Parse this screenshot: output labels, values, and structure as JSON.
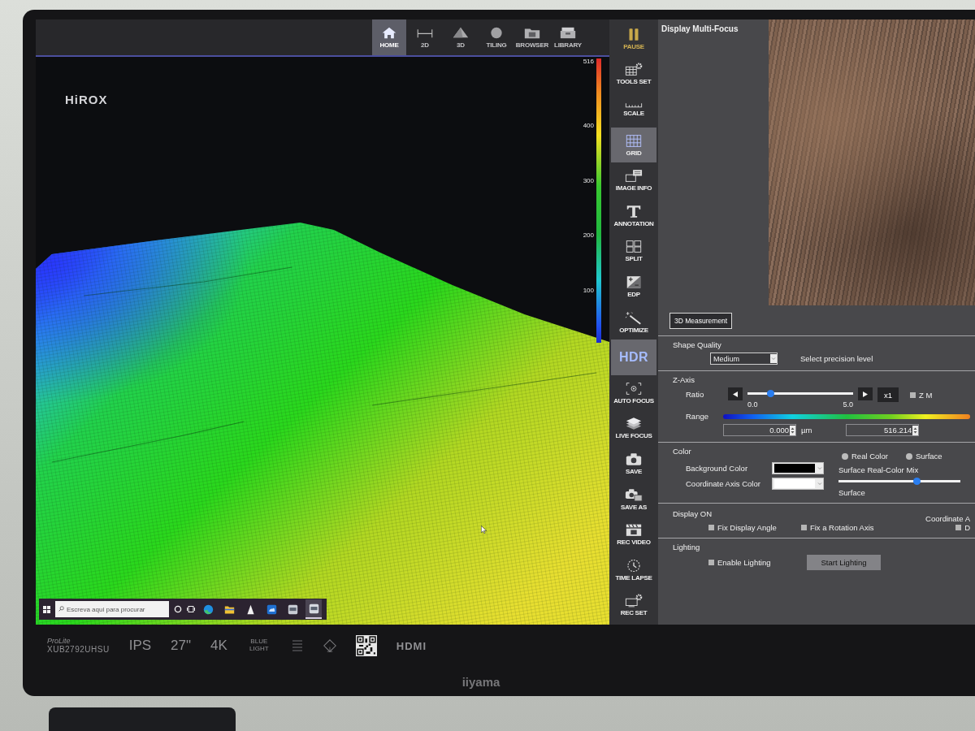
{
  "viewer": {
    "toolbar": [
      {
        "label": "HOME",
        "selected": true
      },
      {
        "label": "2D",
        "selected": false
      },
      {
        "label": "3D",
        "selected": false
      },
      {
        "label": "TILING",
        "selected": false
      },
      {
        "label": "BROWSER",
        "selected": false
      },
      {
        "label": "LIBRARY",
        "selected": false
      }
    ],
    "logo": "HiROX",
    "color_scale": [
      "516",
      "400",
      "300",
      "200",
      "100"
    ]
  },
  "taskbar": {
    "search": {
      "placeholder": "Escreva aqui para procurar"
    },
    "apps": [
      {
        "selected": false
      },
      {
        "selected": false
      },
      {
        "selected": false
      },
      {
        "selected": false
      },
      {
        "selected": false
      },
      {
        "selected": true
      }
    ]
  },
  "tools": [
    {
      "label": "PAUSE",
      "kind": "icon",
      "selected": false
    },
    {
      "label": "TOOLS SET",
      "kind": "icon",
      "selected": false
    },
    {
      "label": "SCALE",
      "kind": "icon",
      "selected": false
    },
    {
      "label": "GRID",
      "kind": "icon",
      "selected": true
    },
    {
      "label": "IMAGE INFO",
      "kind": "icon",
      "selected": false
    },
    {
      "label": "ANNOTATION",
      "kind": "icon",
      "selected": false
    },
    {
      "label": "SPLIT",
      "kind": "icon",
      "selected": false
    },
    {
      "label": "EDP",
      "kind": "icon",
      "selected": false
    },
    {
      "label": "OPTIMIZE",
      "kind": "icon",
      "selected": false
    },
    {
      "label": "HDR",
      "kind": "text",
      "selected": true
    },
    {
      "label": "AUTO FOCUS",
      "kind": "icon",
      "selected": false
    },
    {
      "label": "LIVE FOCUS",
      "kind": "icon",
      "selected": false
    },
    {
      "label": "SAVE",
      "kind": "icon",
      "selected": false
    },
    {
      "label": "SAVE AS",
      "kind": "icon",
      "selected": false
    },
    {
      "label": "REC VIDEO",
      "kind": "icon",
      "selected": false
    },
    {
      "label": "TIME LAPSE",
      "kind": "icon",
      "selected": false
    },
    {
      "label": "REC SET",
      "kind": "icon",
      "selected": false
    }
  ],
  "panel": {
    "title": "Display Multi-Focus",
    "measure_button": "3D Measurement",
    "shape_quality": {
      "title": "Shape Quality",
      "value": "Medium",
      "hint": "Select precision level"
    },
    "z_axis": {
      "title": "Z-Axis",
      "ratio_label": "Ratio",
      "ratio": {
        "level": 0.2,
        "min": "0.0",
        "max": "5.0"
      },
      "multiplier": "x1",
      "z_option": {
        "label": "Z M",
        "checked": false
      },
      "range_label": "Range",
      "range_from": "0.000",
      "unit": "µm",
      "range_to": "516.214"
    },
    "color": {
      "title": "Color",
      "modes": [
        {
          "label": "Real Color",
          "selected": false
        },
        {
          "label": "Surface",
          "selected": false
        }
      ],
      "swatches": [
        {
          "label": "Background Color",
          "color": "#000000"
        },
        {
          "label": "Coordinate Axis Color",
          "color": "#ffffff"
        }
      ],
      "mix": {
        "label": "Surface Real-Color Mix",
        "level": 0.65,
        "end_label": "Surface"
      }
    },
    "display_on": {
      "title": "Display ON",
      "side_label": "Coordinate A",
      "options": [
        {
          "label": "Fix Display Angle",
          "checked": false
        },
        {
          "label": "Fix a Rotation Axis",
          "checked": false
        }
      ],
      "side_option": {
        "label": "D",
        "checked": false
      }
    },
    "lighting": {
      "title": "Lighting",
      "options": [
        {
          "label": "Enable Lighting",
          "checked": false
        }
      ],
      "button": {
        "label": "Start Lighting",
        "disabled": true
      }
    }
  },
  "monitor": {
    "series": "ProLite",
    "model": "XUB2792UHSU",
    "badges": [
      {
        "text": "IPS",
        "kind": "large"
      },
      {
        "text": "27\"",
        "kind": "large"
      },
      {
        "text": "4K",
        "kind": "large"
      },
      {
        "text": "BLUE LIGHT",
        "kind": "small"
      }
    ],
    "port": "HDMI",
    "brand": "iiyama"
  }
}
